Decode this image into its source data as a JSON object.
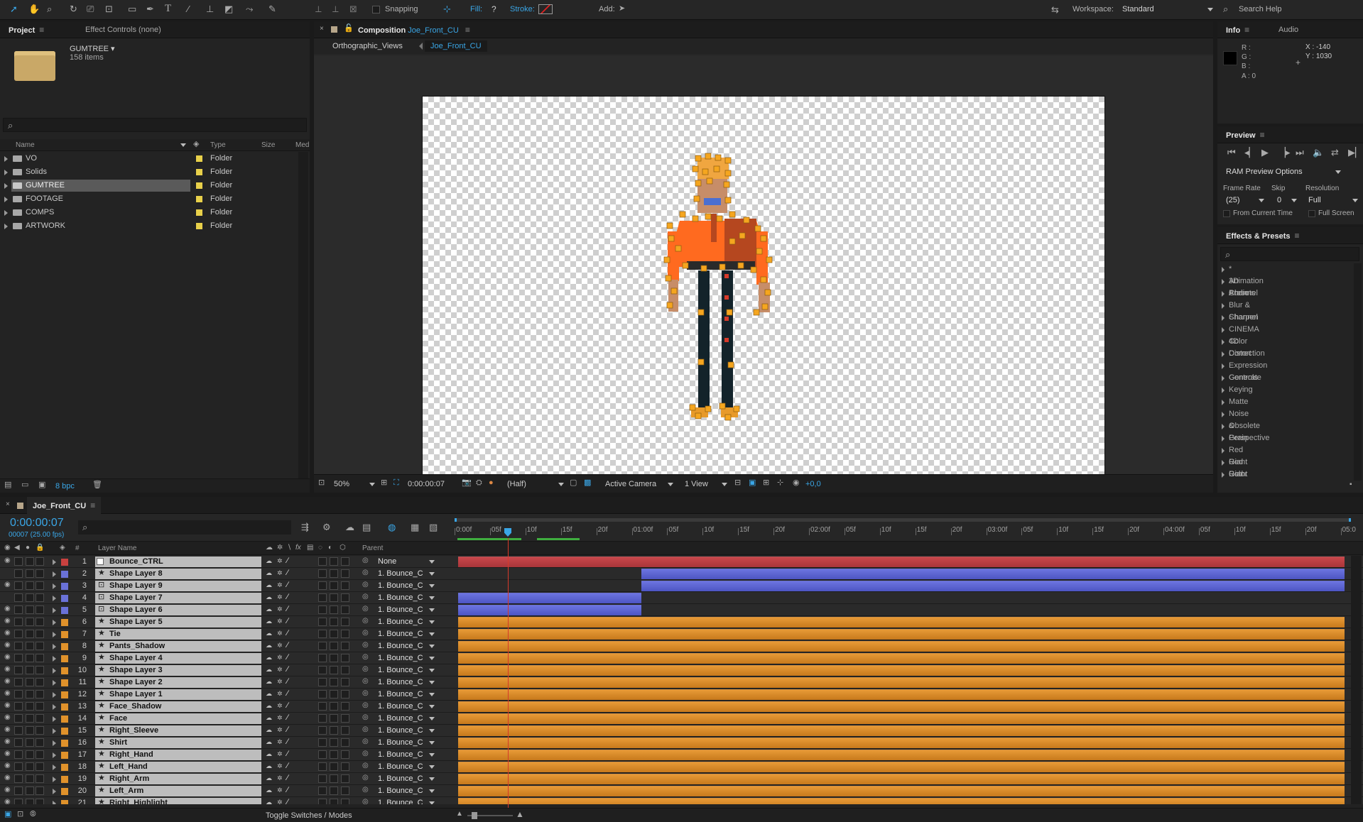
{
  "toolbar": {
    "snapping": "Snapping",
    "fill_label": "Fill:",
    "fill_value": "?",
    "stroke_label": "Stroke:",
    "add_label": "Add:",
    "workspace_label": "Workspace:",
    "workspace_value": "Standard",
    "search_help": "Search Help"
  },
  "project": {
    "tab": "Project",
    "effect_controls_tab": "Effect Controls (none)",
    "selected_name": "GUMTREE ▾",
    "item_count": "158 items",
    "col_name": "Name",
    "col_type": "Type",
    "col_size": "Size",
    "col_med": "Med",
    "bpc": "8 bpc",
    "items": [
      {
        "name": "VO",
        "type": "Folder",
        "selected": false
      },
      {
        "name": "Solids",
        "type": "Folder",
        "selected": false
      },
      {
        "name": "GUMTREE",
        "type": "Folder",
        "selected": true
      },
      {
        "name": "FOOTAGE",
        "type": "Folder",
        "selected": false
      },
      {
        "name": "COMPS",
        "type": "Folder",
        "selected": false
      },
      {
        "name": "ARTWORK",
        "type": "Folder",
        "selected": false
      }
    ]
  },
  "composition": {
    "tab_prefix": "Composition",
    "tab_name": "Joe_Front_CU",
    "crumb1": "Orthographic_Views",
    "crumb2": "Joe_Front_CU",
    "zoom": "50%",
    "timecode": "0:00:00:07",
    "resolution": "(Half)",
    "camera": "Active Camera",
    "views": "1 View",
    "exposure": "+0,0"
  },
  "info": {
    "tab": "Info",
    "audio_tab": "Audio",
    "r": "R :",
    "g": "G :",
    "b": "B :",
    "a": "A : 0",
    "x": "X : -140",
    "y": "Y : 1030"
  },
  "preview": {
    "tab": "Preview",
    "ram_options": "RAM Preview Options",
    "frame_rate_label": "Frame Rate",
    "skip_label": "Skip",
    "resolution_label": "Resolution",
    "frame_rate": "(25)",
    "skip": "0",
    "resolution": "Full",
    "from_current": "From Current Time",
    "full_screen": "Full Screen"
  },
  "effects": {
    "tab": "Effects & Presets",
    "items": [
      "* Animation Presets",
      "3D Channel",
      "Audio",
      "Blur & Sharpen",
      "Channel",
      "CINEMA 4D",
      "Color Correction",
      "Distort",
      "Expression Controls",
      "Generate",
      "Keying",
      "Matte",
      "Noise & Grain",
      "Obsolete",
      "Perspective",
      "Red Giant Color Suite",
      "Red Giant LUT Buddy",
      "Red Giant MisFire"
    ]
  },
  "timeline": {
    "tab": "Joe_Front_CU",
    "timecode": "0:00:00:07",
    "fps": "00007 (25.00 fps)",
    "col_layer_name": "Layer Name",
    "col_parent": "Parent",
    "col_num": "#",
    "toggle_label": "Toggle Switches / Modes",
    "ruler": [
      "0:00f",
      "05f",
      "10f",
      "15f",
      "20f",
      "01:00f",
      "05f",
      "10f",
      "15f",
      "20f",
      "02:00f",
      "05f",
      "10f",
      "15f",
      "20f",
      "03:00f",
      "05f",
      "10f",
      "15f",
      "20f",
      "04:00f",
      "05f",
      "10f",
      "15f",
      "20f",
      "05:0"
    ],
    "layers": [
      {
        "num": "1",
        "name": "Bounce_CTRL",
        "parent": "None",
        "label": "#c8413f",
        "kind": "null",
        "bar": "red"
      },
      {
        "num": "2",
        "name": "Shape Layer 8",
        "parent": "1. Bounce_C",
        "label": "#6a72d8",
        "kind": "star",
        "bar": "blue-late"
      },
      {
        "num": "3",
        "name": "Shape Layer 9",
        "parent": "1. Bounce_C",
        "label": "#6a72d8",
        "kind": "comp",
        "bar": "blue-late"
      },
      {
        "num": "4",
        "name": "Shape Layer 7",
        "parent": "1. Bounce_C",
        "label": "#6a72d8",
        "kind": "comp",
        "bar": "blue-early"
      },
      {
        "num": "5",
        "name": "Shape Layer 6",
        "parent": "1. Bounce_C",
        "label": "#6a72d8",
        "kind": "comp",
        "bar": "blue-early"
      },
      {
        "num": "6",
        "name": "Shape Layer 5",
        "parent": "1. Bounce_C",
        "label": "#e0922b",
        "kind": "star",
        "bar": "orange"
      },
      {
        "num": "7",
        "name": "Tie",
        "parent": "1. Bounce_C",
        "label": "#e0922b",
        "kind": "star",
        "bar": "orange"
      },
      {
        "num": "8",
        "name": "Pants_Shadow",
        "parent": "1. Bounce_C",
        "label": "#e0922b",
        "kind": "star",
        "bar": "orange"
      },
      {
        "num": "9",
        "name": "Shape Layer 4",
        "parent": "1. Bounce_C",
        "label": "#e0922b",
        "kind": "star",
        "bar": "orange"
      },
      {
        "num": "10",
        "name": "Shape Layer 3",
        "parent": "1. Bounce_C",
        "label": "#e0922b",
        "kind": "star",
        "bar": "orange"
      },
      {
        "num": "11",
        "name": "Shape Layer 2",
        "parent": "1. Bounce_C",
        "label": "#e0922b",
        "kind": "star",
        "bar": "orange"
      },
      {
        "num": "12",
        "name": "Shape Layer 1",
        "parent": "1. Bounce_C",
        "label": "#e0922b",
        "kind": "star",
        "bar": "orange"
      },
      {
        "num": "13",
        "name": "Face_Shadow",
        "parent": "1. Bounce_C",
        "label": "#e0922b",
        "kind": "star",
        "bar": "orange"
      },
      {
        "num": "14",
        "name": "Face",
        "parent": "1. Bounce_C",
        "label": "#e0922b",
        "kind": "star",
        "bar": "orange"
      },
      {
        "num": "15",
        "name": "Right_Sleeve",
        "parent": "1. Bounce_C",
        "label": "#e0922b",
        "kind": "star",
        "bar": "orange"
      },
      {
        "num": "16",
        "name": "Shirt",
        "parent": "1. Bounce_C",
        "label": "#e0922b",
        "kind": "star",
        "bar": "orange"
      },
      {
        "num": "17",
        "name": "Right_Hand",
        "parent": "1. Bounce_C",
        "label": "#e0922b",
        "kind": "star",
        "bar": "orange"
      },
      {
        "num": "18",
        "name": "Left_Hand",
        "parent": "1. Bounce_C",
        "label": "#e0922b",
        "kind": "star",
        "bar": "orange"
      },
      {
        "num": "19",
        "name": "Right_Arm",
        "parent": "1. Bounce_C",
        "label": "#e0922b",
        "kind": "star",
        "bar": "orange"
      },
      {
        "num": "20",
        "name": "Left_Arm",
        "parent": "1. Bounce_C",
        "label": "#e0922b",
        "kind": "star",
        "bar": "orange"
      },
      {
        "num": "21",
        "name": "Right_Highlight",
        "parent": "1. Bounce_C",
        "label": "#e0922b",
        "kind": "star",
        "bar": "orange"
      }
    ]
  },
  "colors": {
    "accent": "#3aa6e6",
    "folder_label": "#e8d04a",
    "playhead": "#d63a2a"
  }
}
